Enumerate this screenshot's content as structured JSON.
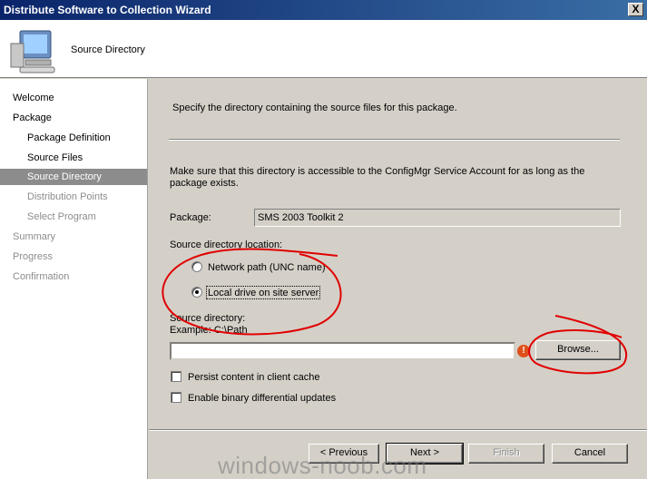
{
  "window": {
    "title": "Distribute Software to Collection Wizard",
    "close_label": "X"
  },
  "header": {
    "page_title": "Source Directory",
    "icon": "computer-icon"
  },
  "sidebar": {
    "items": [
      {
        "label": "Welcome",
        "state": "normal"
      },
      {
        "label": "Package",
        "state": "normal"
      },
      {
        "label": "Package Definition",
        "state": "normal"
      },
      {
        "label": "Source Files",
        "state": "normal"
      },
      {
        "label": "Source Directory",
        "state": "selected"
      },
      {
        "label": "Distribution Points",
        "state": "dim"
      },
      {
        "label": "Select Program",
        "state": "dim"
      },
      {
        "label": "Summary",
        "state": "dim"
      },
      {
        "label": "Progress",
        "state": "dim"
      },
      {
        "label": "Confirmation",
        "state": "dim"
      }
    ]
  },
  "main": {
    "intro": "Specify the directory containing the source files for this package.",
    "note": "Make sure that this directory is accessible to the ConfigMgr Service Account for as long as the package exists.",
    "package_label": "Package:",
    "package_value": "SMS 2003 Toolkit 2",
    "location_label": "Source directory location:",
    "radio_network": "Network path (UNC name)",
    "radio_local": "Local drive on site server",
    "selected_option": "Local drive on site server",
    "source_dir_label": "Source directory:",
    "example": "Example: C:\\Path",
    "source_dir_value": "",
    "browse": "Browse...",
    "persist_label": "Persist content in client cache",
    "persist_checked": false,
    "binary_label": "Enable binary differential updates",
    "binary_checked": false
  },
  "footer": {
    "previous": "< Previous",
    "next": "Next >",
    "finish": "Finish",
    "cancel": "Cancel"
  },
  "watermark": "windows-noob.com",
  "colors": {
    "title_bar": "#0a246a",
    "selected_nav": "#8c8c8c",
    "annotation": "#e00000",
    "warning": "#e0501c"
  }
}
